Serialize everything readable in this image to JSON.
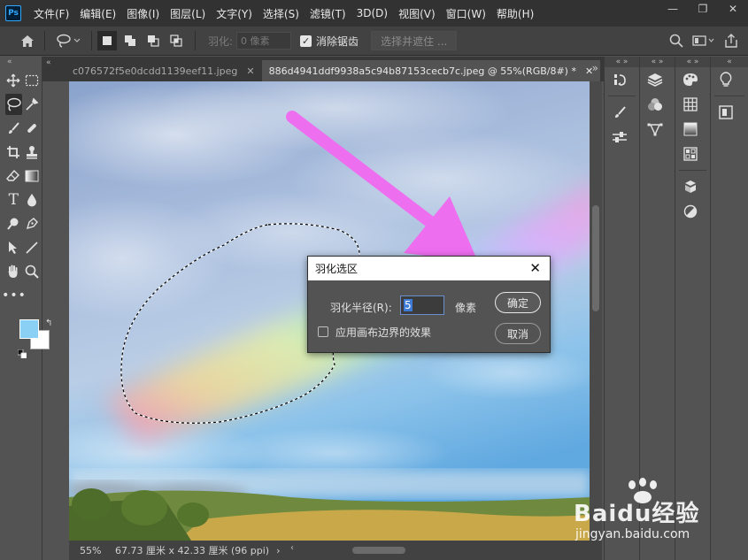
{
  "app": {
    "logo": "Ps",
    "menu": [
      "文件(F)",
      "编辑(E)",
      "图像(I)",
      "图层(L)",
      "文字(Y)",
      "选择(S)",
      "滤镜(T)",
      "3D(D)",
      "视图(V)",
      "窗口(W)",
      "帮助(H)"
    ],
    "window_controls": [
      "minimize-icon",
      "restore-icon",
      "close-icon"
    ]
  },
  "options_bar": {
    "feather_label": "羽化:",
    "feather_value": "0 像素",
    "antialias_label": "消除锯齿",
    "antialias_checked": true,
    "select_mask_label": "选择并遮住 ..."
  },
  "tabs": [
    {
      "title": "c076572f5e0dcdd1139eef11.jpeg",
      "active": false
    },
    {
      "title": "886d4941ddf9938a5c94b87153cecb7c.jpeg @ 55%(RGB/8#) *",
      "active": true
    }
  ],
  "status": {
    "zoom": "55%",
    "doc_size": "67.73 厘米 x 42.33 厘米 (96 ppi)"
  },
  "dialog": {
    "title": "羽化选区",
    "radius_label": "羽化半径(R):",
    "radius_value": "5",
    "radius_unit": "像素",
    "canvas_edge_label": "应用画布边界的效果",
    "canvas_edge_checked": false,
    "ok_label": "确定",
    "cancel_label": "取消"
  },
  "colors": {
    "foreground": "#8ad0f5",
    "background": "#ffffff",
    "annotation_arrow": "#ee6ef0"
  },
  "watermark": {
    "brand": "Baidu经验",
    "url": "jingyan.baidu.com"
  }
}
